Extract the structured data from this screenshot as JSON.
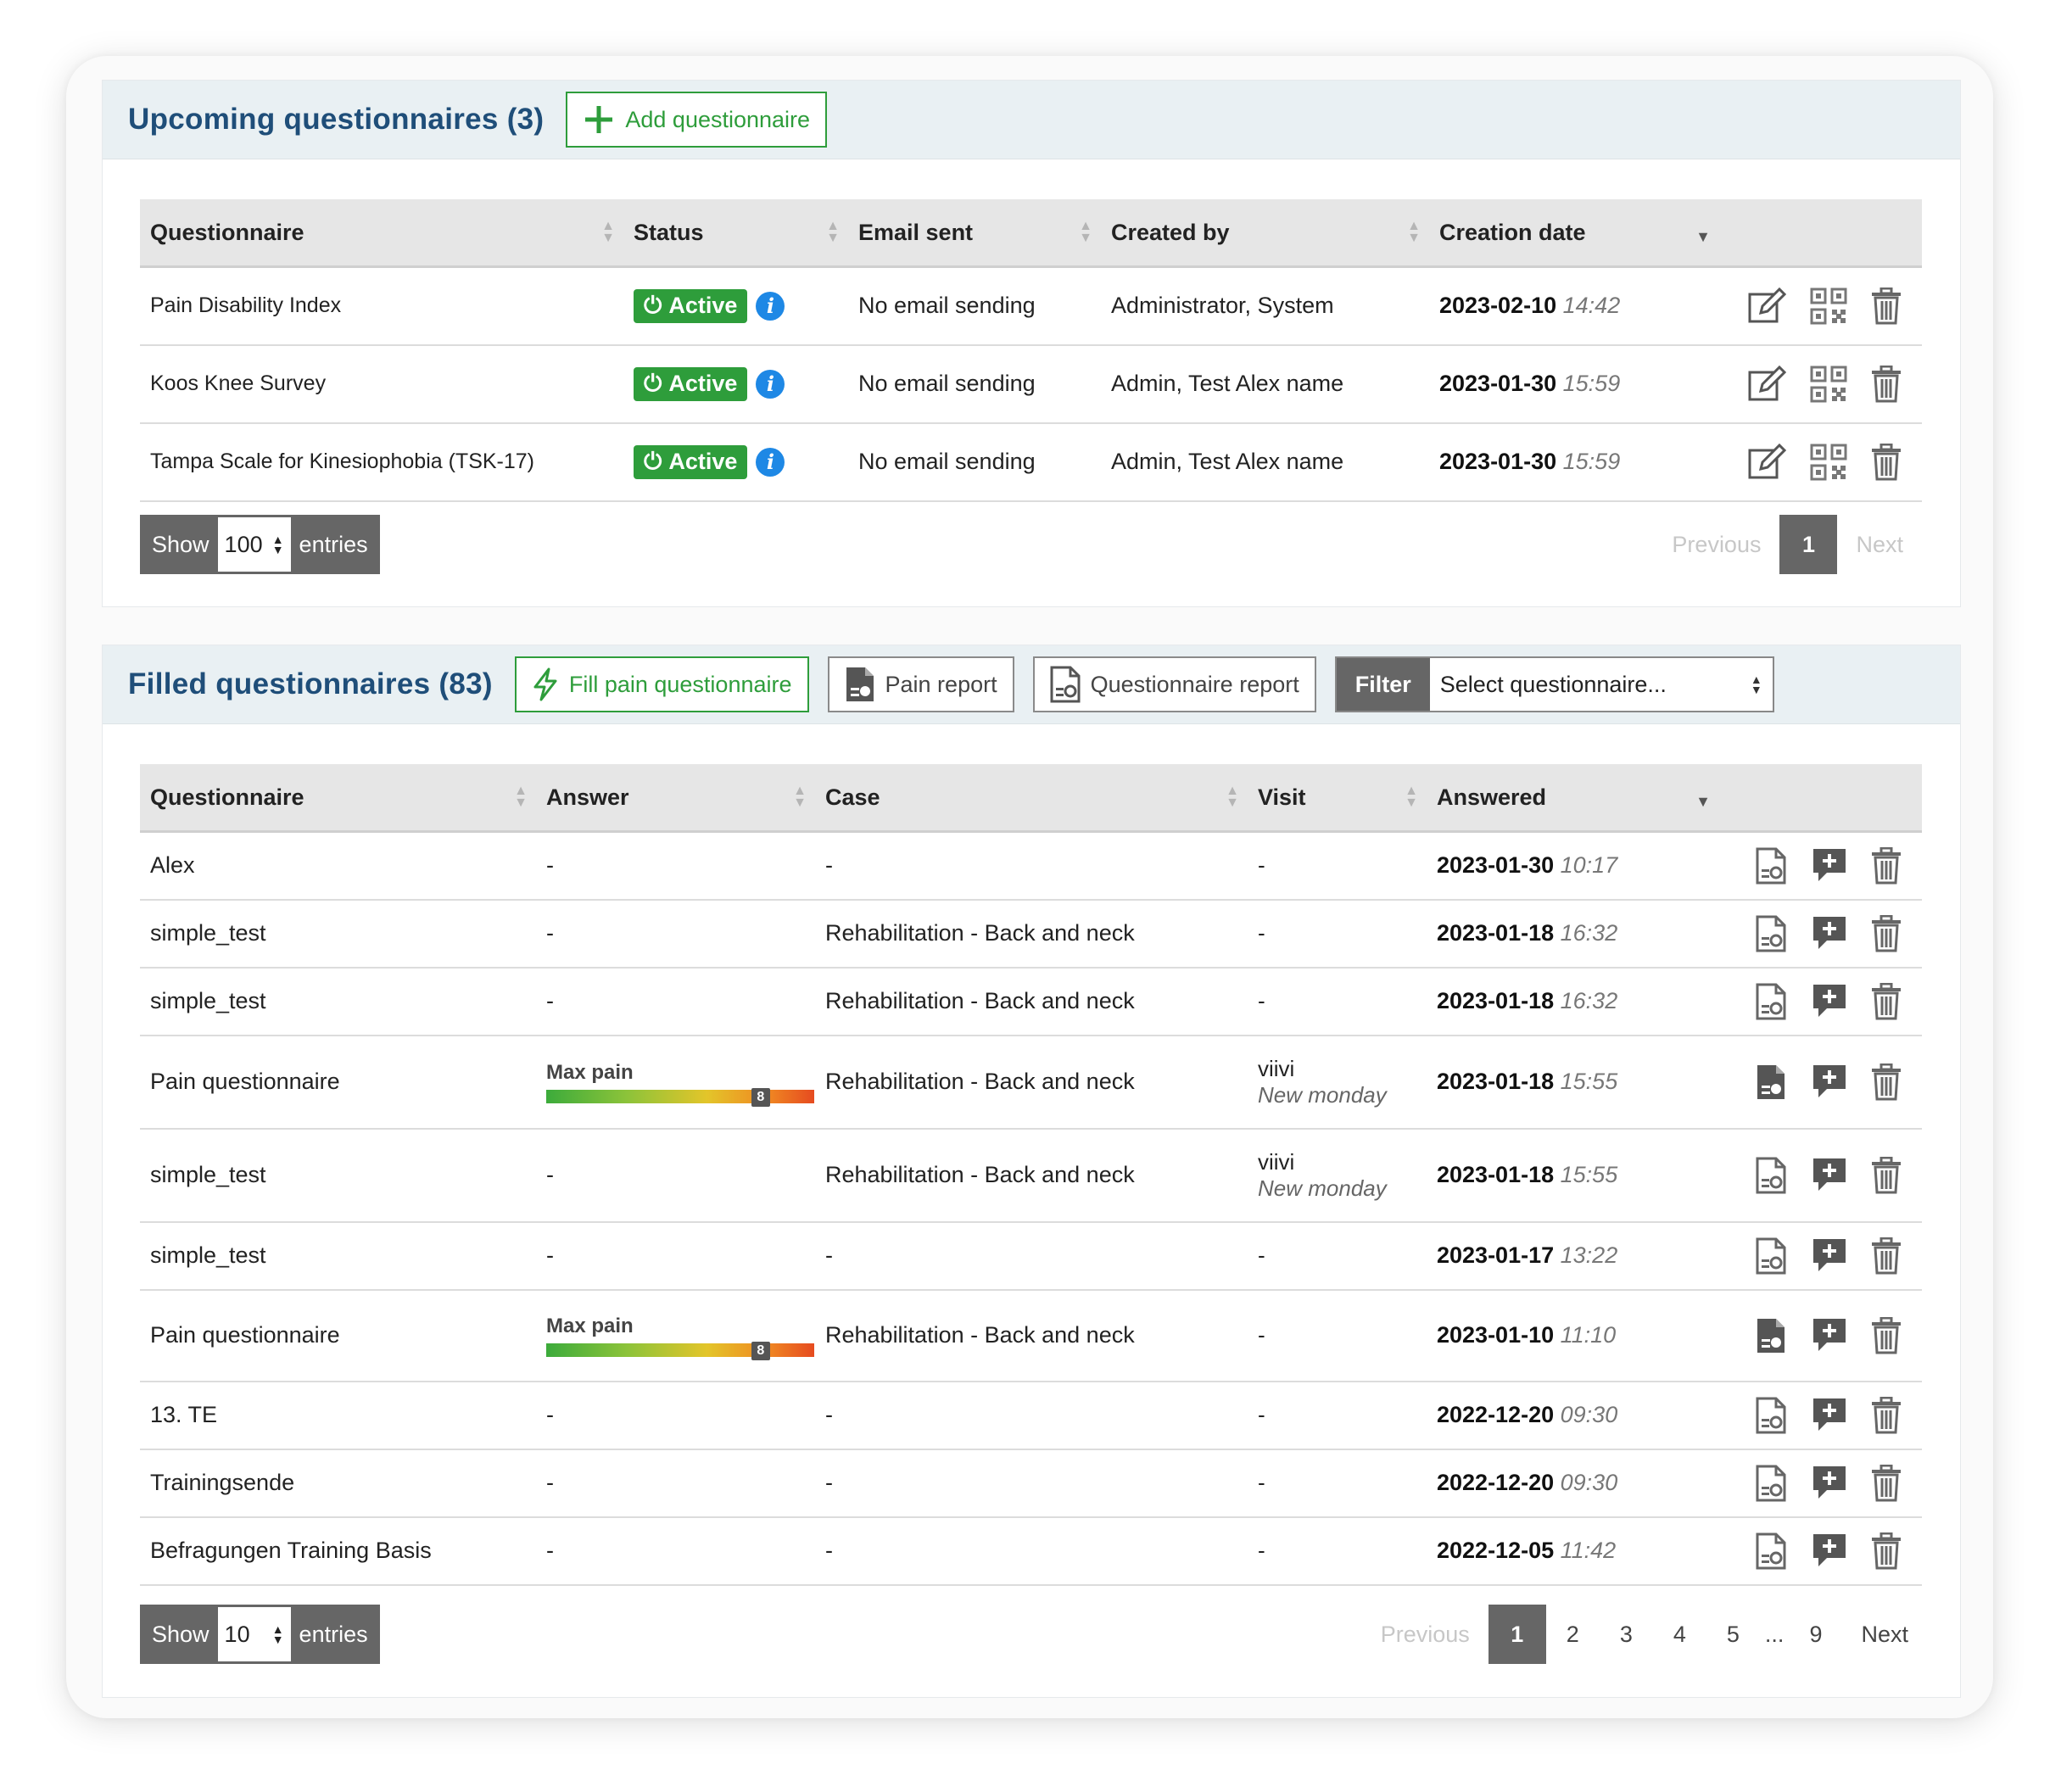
{
  "upcoming": {
    "title": "Upcoming questionnaires (3)",
    "add_button": "Add questionnaire",
    "columns": [
      "Questionnaire",
      "Status",
      "Email sent",
      "Created by",
      "Creation date"
    ],
    "rows": [
      {
        "name": "Pain Disability Index",
        "status": "Active",
        "email": "No email sending",
        "created_by": "Administrator, System",
        "date": "2023-02-10",
        "time": "14:42"
      },
      {
        "name": "Koos Knee Survey",
        "status": "Active",
        "email": "No email sending",
        "created_by": "Admin, Test Alex name",
        "date": "2023-01-30",
        "time": "15:59"
      },
      {
        "name": "Tampa Scale for Kinesiophobia (TSK-17)",
        "status": "Active",
        "email": "No email sending",
        "created_by": "Admin, Test Alex name",
        "date": "2023-01-30",
        "time": "15:59"
      }
    ],
    "show_label": "Show",
    "entries_value": "100",
    "entries_label": "entries",
    "pager": {
      "previous": "Previous",
      "current": "1",
      "next": "Next"
    }
  },
  "filled": {
    "title": "Filled questionnaires (83)",
    "fill_button": "Fill pain questionnaire",
    "pain_report_button": "Pain report",
    "questionnaire_report_button": "Questionnaire report",
    "filter_label": "Filter",
    "filter_placeholder": "Select questionnaire...",
    "columns": [
      "Questionnaire",
      "Answer",
      "Case",
      "Visit",
      "Answered"
    ],
    "rows": [
      {
        "name": "Alex",
        "answer": "-",
        "case": "-",
        "visit": "-",
        "visit_sub": "",
        "date": "2023-01-30",
        "time": "10:17"
      },
      {
        "name": "simple_test",
        "answer": "-",
        "case": "Rehabilitation - Back and neck",
        "visit": "-",
        "visit_sub": "",
        "date": "2023-01-18",
        "time": "16:32"
      },
      {
        "name": "simple_test",
        "answer": "-",
        "case": "Rehabilitation - Back and neck",
        "visit": "-",
        "visit_sub": "",
        "date": "2023-01-18",
        "time": "16:32"
      },
      {
        "name": "Pain questionnaire",
        "answer": "pain",
        "pain_label": "Max pain",
        "pain_value": "8",
        "case": "Rehabilitation - Back and neck",
        "visit": "viivi",
        "visit_sub": "New monday",
        "date": "2023-01-18",
        "time": "15:55"
      },
      {
        "name": "simple_test",
        "answer": "-",
        "case": "Rehabilitation - Back and neck",
        "visit": "viivi",
        "visit_sub": "New monday",
        "date": "2023-01-18",
        "time": "15:55"
      },
      {
        "name": "simple_test",
        "answer": "-",
        "case": "-",
        "visit": "-",
        "visit_sub": "",
        "date": "2023-01-17",
        "time": "13:22"
      },
      {
        "name": "Pain questionnaire",
        "answer": "pain",
        "pain_label": "Max pain",
        "pain_value": "8",
        "case": "Rehabilitation - Back and neck",
        "visit": "-",
        "visit_sub": "",
        "date": "2023-01-10",
        "time": "11:10"
      },
      {
        "name": "13. TE",
        "answer": "-",
        "case": "-",
        "visit": "-",
        "visit_sub": "",
        "date": "2022-12-20",
        "time": "09:30"
      },
      {
        "name": "Trainingsende",
        "answer": "-",
        "case": "-",
        "visit": "-",
        "visit_sub": "",
        "date": "2022-12-20",
        "time": "09:30"
      },
      {
        "name": "Befragungen Training Basis",
        "answer": "-",
        "case": "-",
        "visit": "-",
        "visit_sub": "",
        "date": "2022-12-05",
        "time": "11:42"
      }
    ],
    "show_label": "Show",
    "entries_value": "10",
    "entries_label": "entries",
    "pager": {
      "previous": "Previous",
      "current": "1",
      "pages": [
        "2",
        "3",
        "4",
        "5"
      ],
      "ellipsis": "...",
      "last": "9",
      "next": "Next"
    }
  },
  "colors": {
    "accent": "#2e9d3b",
    "title": "#1f4e79",
    "info": "#1e88e5",
    "header_bg": "#e9f0f3"
  }
}
